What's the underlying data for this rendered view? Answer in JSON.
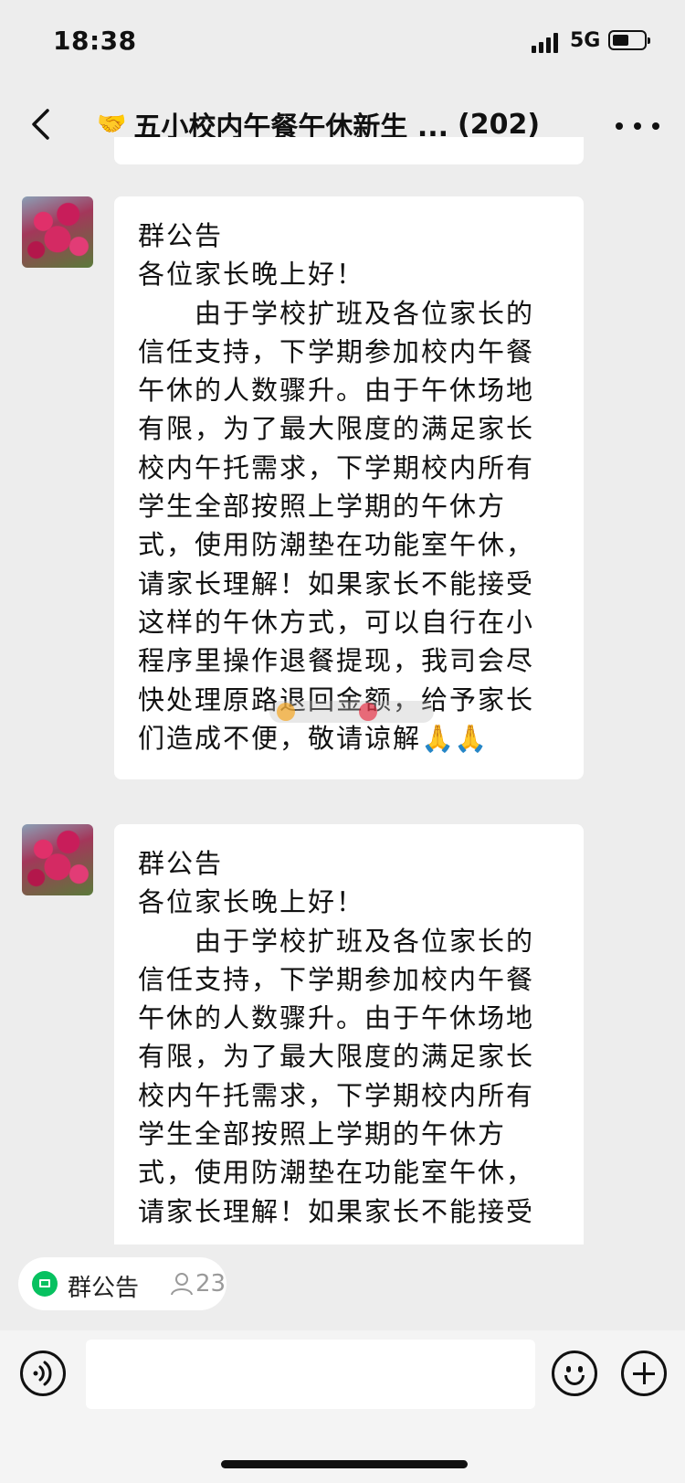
{
  "status_bar": {
    "time": "18:38",
    "network": "5G",
    "battery_level": 0.5
  },
  "nav": {
    "title_emoji": "🤝",
    "title": "五小校内午餐午休新生 ...",
    "member_count": "(202)"
  },
  "messages": [
    {
      "heading": "群公告",
      "greeting": "各位家长晚上好！",
      "body": "由于学校扩班及各位家长的信任支持，下学期参加校内午餐午休的人数骤升。由于午休场地有限，为了最大限度的满足家长校内午托需求，下学期校内所有学生全部按照上学期的午休方式，使用防潮垫在功能室午休，请家长理解！如果家长不能接受这样的午休方式，可以自行在小程序里操作退餐提现，我司会尽快处理原路退回金额，给予家长们造成不便，敬请谅解",
      "trailing_emoji": "🙏🙏"
    },
    {
      "heading": "群公告",
      "greeting": "各位家长晚上好！",
      "body": "由于学校扩班及各位家长的信任支持，下学期参加校内午餐午休的人数骤升。由于午休场地有限，为了最大限度的满足家长校内午托需求，下学期校内所有学生全部按照上学期的午休方式，使用防潮垫在功能室午休，请家长理解！如果家长不能接受"
    }
  ],
  "notice_chip": {
    "label": "群公告",
    "count": "23"
  },
  "input_bar": {
    "placeholder": ""
  },
  "colors": {
    "background": "#ededed",
    "bubble": "#ffffff",
    "wechat_green": "#07c160"
  }
}
